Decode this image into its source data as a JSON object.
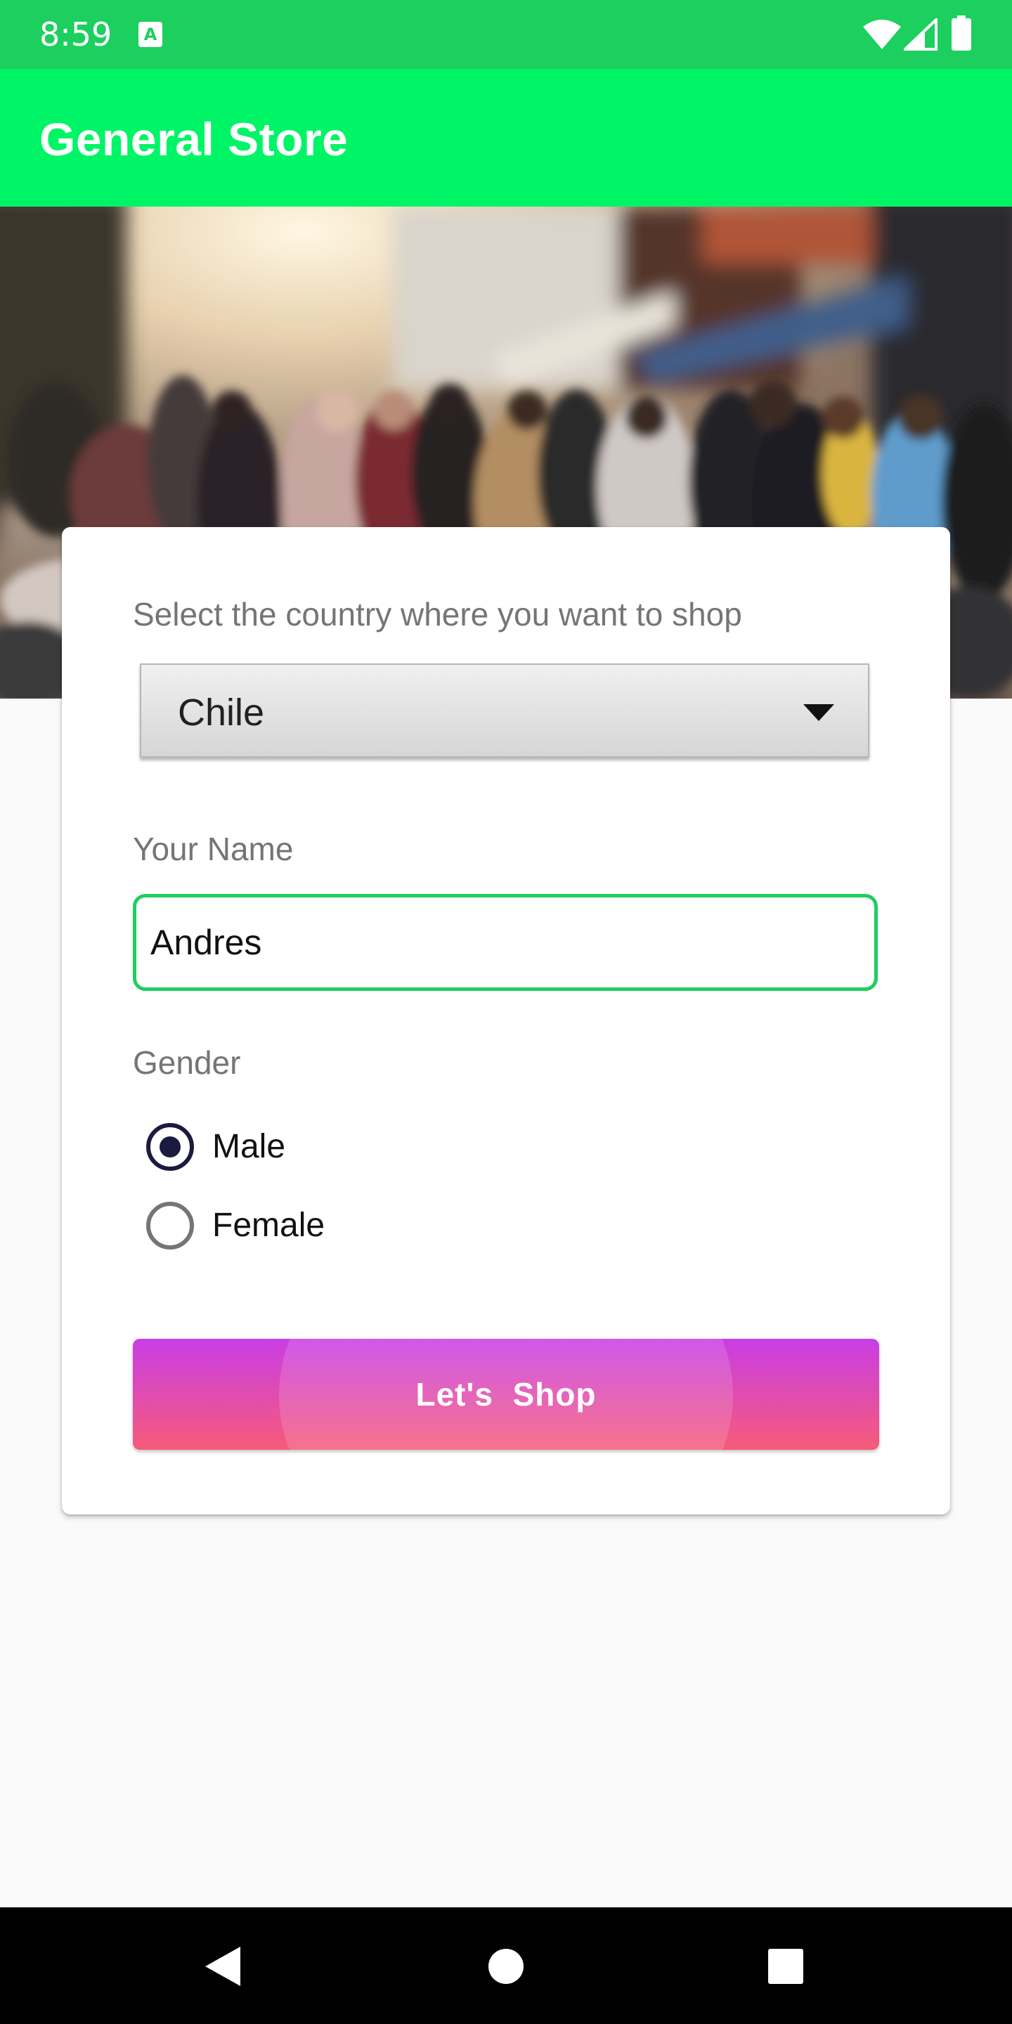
{
  "status_bar": {
    "time": "8:59",
    "icons": [
      "notification-a-icon",
      "wifi-icon",
      "cell-signal-icon",
      "battery-icon"
    ]
  },
  "app_bar": {
    "title": "General Store",
    "color": "#00f566"
  },
  "hero": {
    "description_icon": "street-crowd-image"
  },
  "form": {
    "country_label": "Select the country where you want to shop",
    "country_value": "Chile",
    "name_label": "Your Name",
    "name_value": "Andres",
    "gender_label": "Gender",
    "gender_options": [
      {
        "label": "Male",
        "checked": true
      },
      {
        "label": "Female",
        "checked": false
      }
    ],
    "submit_label": "Let's  Shop"
  },
  "colors": {
    "status_bar": "#1ccf5f",
    "app_bar": "#00f566",
    "input_focus": "#1ccf5f",
    "radio_checked": "#1b1a3f",
    "button_gradient_top": "#c93de6",
    "button_gradient_bottom": "#f75b79"
  },
  "nav_bar": {
    "icons": [
      "back-icon",
      "home-icon",
      "recents-icon"
    ]
  }
}
